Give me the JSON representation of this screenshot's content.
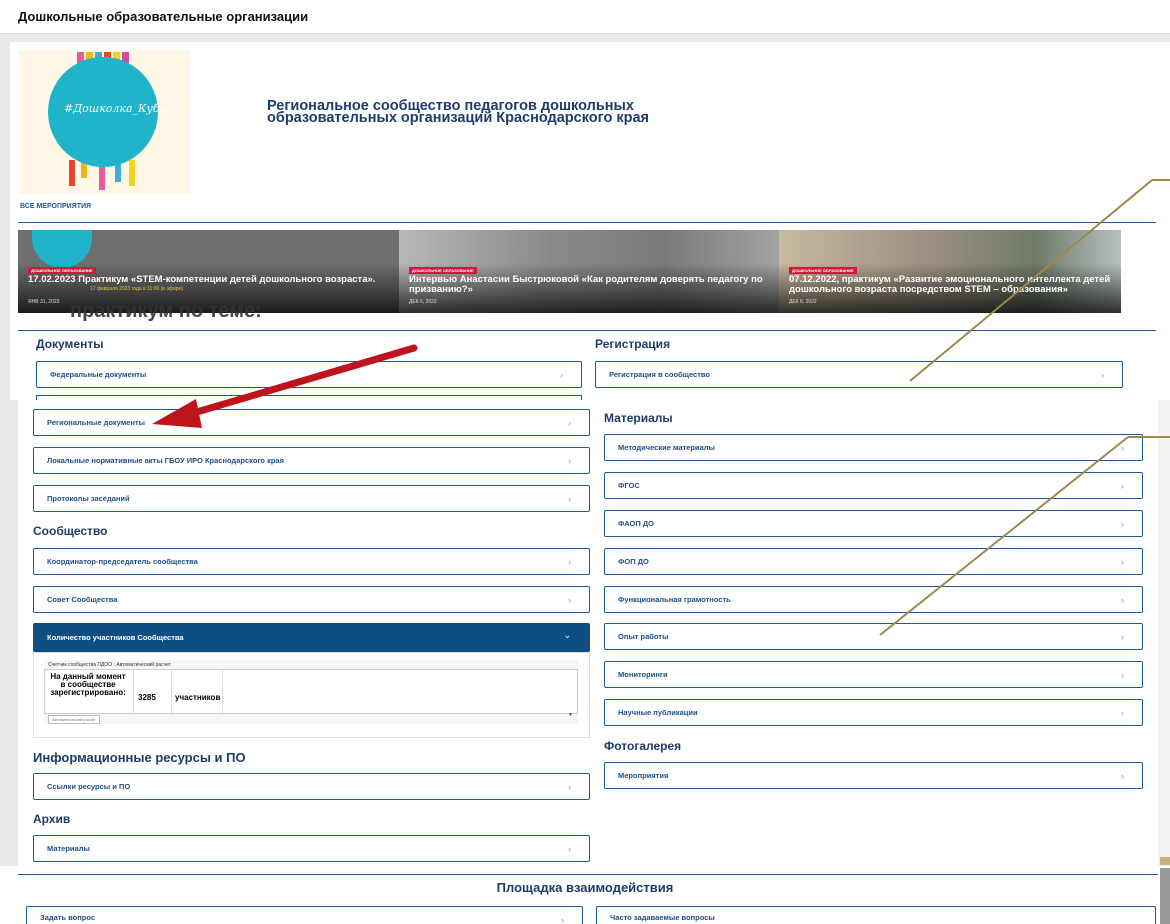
{
  "page_title": "Дошкольные образовательные организации",
  "logo_text": "#Дошколка_Кубани",
  "org_title": "Региональное сообщество педагогов дошкольных образовательных организаций Краснодарского края",
  "all_events": "ВСЕ МЕРОПРИЯТИЯ",
  "slides": [
    {
      "category": "ДОШКОЛЬНОЕ ОБРАЗОВАНИЕ",
      "title": "17.02.2023 Практикум «STEM-компетенции детей дошкольного возраста».",
      "subtext": "17 февраля 2023 года в 11:00 (в эфире)",
      "date": "ЯНВ 31, 2023"
    },
    {
      "category": "ДОШКОЛЬНОЕ ОБРАЗОВАНИЕ",
      "title": "Интервью Анастасии Быстрюковой «Как родителям доверять педагогу по призванию?»",
      "date": "ДЕК 6, 2022"
    },
    {
      "category": "ДОШКОЛЬНОЕ ОБРАЗОВАНИЕ",
      "title": "07.12.2022, практикум «Развитие эмоционального интеллекта детей дошкольного возраста посредством STEM – образования»",
      "date": "ДЕК 6, 2022"
    }
  ],
  "ghost_text": "практикум по теме:",
  "sections": {
    "documents": "Документы",
    "registration": "Регистрация",
    "materials": "Материалы",
    "community": "Сообщество",
    "info": "Информационные ресурсы и ПО",
    "archive": "Архив",
    "gallery": "Фотогалерея",
    "interaction": "Площадка взаимодействия"
  },
  "buttons": {
    "federal": "Федеральные документы",
    "registration": "Регистрация в сообщество",
    "regional": "Региональные документы",
    "local": "Локальные нормативные акты ГБОУ ИРО Краснодарского края",
    "protocols": "Протоколы заседаний",
    "coordinator": "Координатор-председатель сообщества",
    "council": "Совет Сообщества",
    "members": "Количество участников Сообщества",
    "links": "Ссылки ресурсы и ПО",
    "archive_materials": "Материалы",
    "methodical": "Методические материалы",
    "fgos": "ФГОС",
    "faop": "ФАОП ДО",
    "fop": "ФОП ДО",
    "literacy": "Функциональная грамотность",
    "experience": "Опыт работы",
    "monitoring": "Мониторинги",
    "publications": "Научные публикации",
    "events": "Мероприятия",
    "ask": "Задать вопрос",
    "faq": "Часто задаваемые вопросы"
  },
  "chevron": "›",
  "chevron_down": "⌄",
  "counter": {
    "header": "Счетчик сообщества ПДОО : Автоматический расчет",
    "label": "На данный момент в сообществе зарегистрировано:",
    "value": "3285",
    "unit": "участников",
    "footer_btn": "Автоматический расчет"
  },
  "colors": {
    "brand": "#1e5a96",
    "active": "#0f4e83",
    "arrow": "#c0141c",
    "pointer": "#9c8a4a"
  }
}
